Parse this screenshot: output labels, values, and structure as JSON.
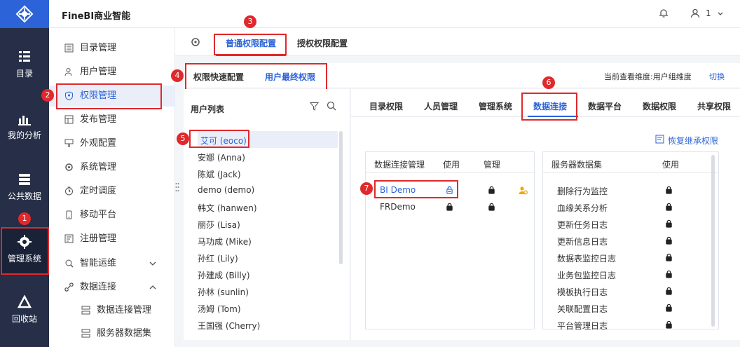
{
  "app": {
    "brand": "FineBI商业智能",
    "user": "1"
  },
  "leftbar": {
    "items": [
      {
        "key": "catalog",
        "label": "目录"
      },
      {
        "key": "analysis",
        "label": "我的分析"
      },
      {
        "key": "public",
        "label": "公共数据"
      },
      {
        "key": "admin",
        "label": "管理系统"
      },
      {
        "key": "recycle",
        "label": "回收站"
      }
    ]
  },
  "secnav": {
    "items": [
      {
        "label": "目录管理",
        "icon": "catalog-manage-icon"
      },
      {
        "label": "用户管理",
        "icon": "user-manage-icon"
      },
      {
        "label": "权限管理",
        "icon": "permission-icon"
      },
      {
        "label": "发布管理",
        "icon": "publish-icon"
      },
      {
        "label": "外观配置",
        "icon": "appearance-icon"
      },
      {
        "label": "系统管理",
        "icon": "gear-icon"
      },
      {
        "label": "定时调度",
        "icon": "timer-icon"
      },
      {
        "label": "移动平台",
        "icon": "mobile-icon"
      },
      {
        "label": "注册管理",
        "icon": "register-icon"
      },
      {
        "label": "智能运维",
        "icon": "ops-icon"
      },
      {
        "label": "数据连接",
        "icon": "link-icon"
      },
      {
        "label": "数据连接管理",
        "icon": "db-conn-icon"
      },
      {
        "label": "服务器数据集",
        "icon": "server-dataset-icon"
      }
    ]
  },
  "tabs1": {
    "normal": "普通权限配置",
    "grant": "授权权限配置"
  },
  "tabs2": {
    "quick": "权限快速配置",
    "final": "用户最终权限",
    "dimension": "当前查看维度:用户组维度",
    "switch": "切换"
  },
  "userlist": {
    "title": "用户列表",
    "users": [
      "艾可 (eoco)",
      "安娜 (Anna)",
      "陈斌 (Jack)",
      "demo (demo)",
      "韩文 (hanwen)",
      "丽莎 (Lisa)",
      "马功成 (Mike)",
      "孙红 (Lily)",
      "孙建成 (Billy)",
      "孙林 (sunlin)",
      "汤姆 (Tom)",
      "王国强 (Cherry)"
    ]
  },
  "permtabs": [
    "目录权限",
    "人员管理",
    "管理系统",
    "数据连接",
    "数据平台",
    "数据权限",
    "共享权限"
  ],
  "restore": "恢复继承权限",
  "connpanel": {
    "h1": "数据连接管理",
    "h2": "使用",
    "h3": "管理",
    "rows": [
      "BI Demo",
      "FRDemo"
    ]
  },
  "serverpanel": {
    "h1": "服务器数据集",
    "h2": "使用",
    "rows": [
      "删除行为监控",
      "血缘关系分析",
      "更新任务日志",
      "更新信息日志",
      "数据表监控日志",
      "业务包监控日志",
      "模板执行日志",
      "关联配置日志",
      "平台管理日志"
    ]
  },
  "badges": [
    "1",
    "2",
    "3",
    "4",
    "5",
    "6",
    "7"
  ]
}
